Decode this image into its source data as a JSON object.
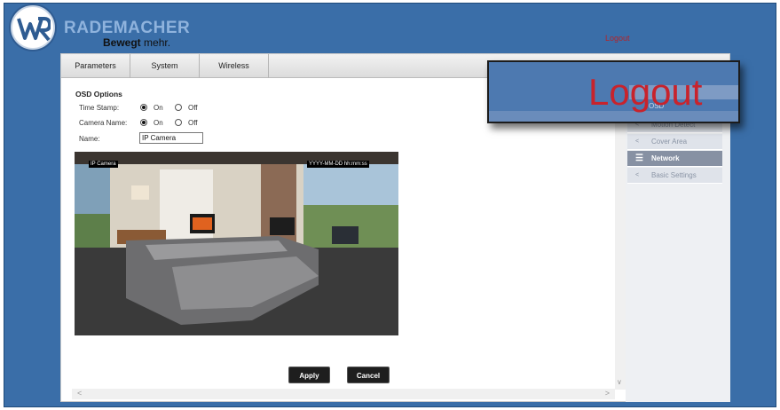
{
  "brand": {
    "name": "RADEMACHER",
    "slogan_bold": "Bewegt",
    "slogan_rest": " mehr."
  },
  "header": {
    "logout_label": "Logout"
  },
  "tabs": [
    {
      "label": "Parameters"
    },
    {
      "label": "System"
    },
    {
      "label": "Wireless"
    }
  ],
  "osd": {
    "title": "OSD Options",
    "time_stamp": {
      "label": "Time Stamp:",
      "on": "On",
      "off": "Off",
      "selected": "on"
    },
    "camera_name": {
      "label": "Camera Name:",
      "on": "On",
      "off": "Off",
      "selected": "on"
    },
    "name": {
      "label": "Name:",
      "value": "IP Camera"
    }
  },
  "camera_preview": {
    "name_overlay": "IP Camera",
    "timestamp_overlay": "YYYY-MM-DD hh:mm:ss"
  },
  "buttons": {
    "apply": "Apply",
    "cancel": "Cancel"
  },
  "sidebar": {
    "items": [
      {
        "label": "Motion Detect",
        "active": false
      },
      {
        "label": "Cover Area",
        "active": false
      },
      {
        "label": "Network",
        "active": true
      },
      {
        "label": "Basic Settings",
        "active": false
      }
    ]
  },
  "zoom_callout": {
    "text": "Logout",
    "partial_label": "OSD"
  },
  "colors": {
    "background": "#3a6ea8",
    "logout": "#c8232c",
    "sidebar_active": "#8791a3",
    "button": "#1e1e1e"
  }
}
